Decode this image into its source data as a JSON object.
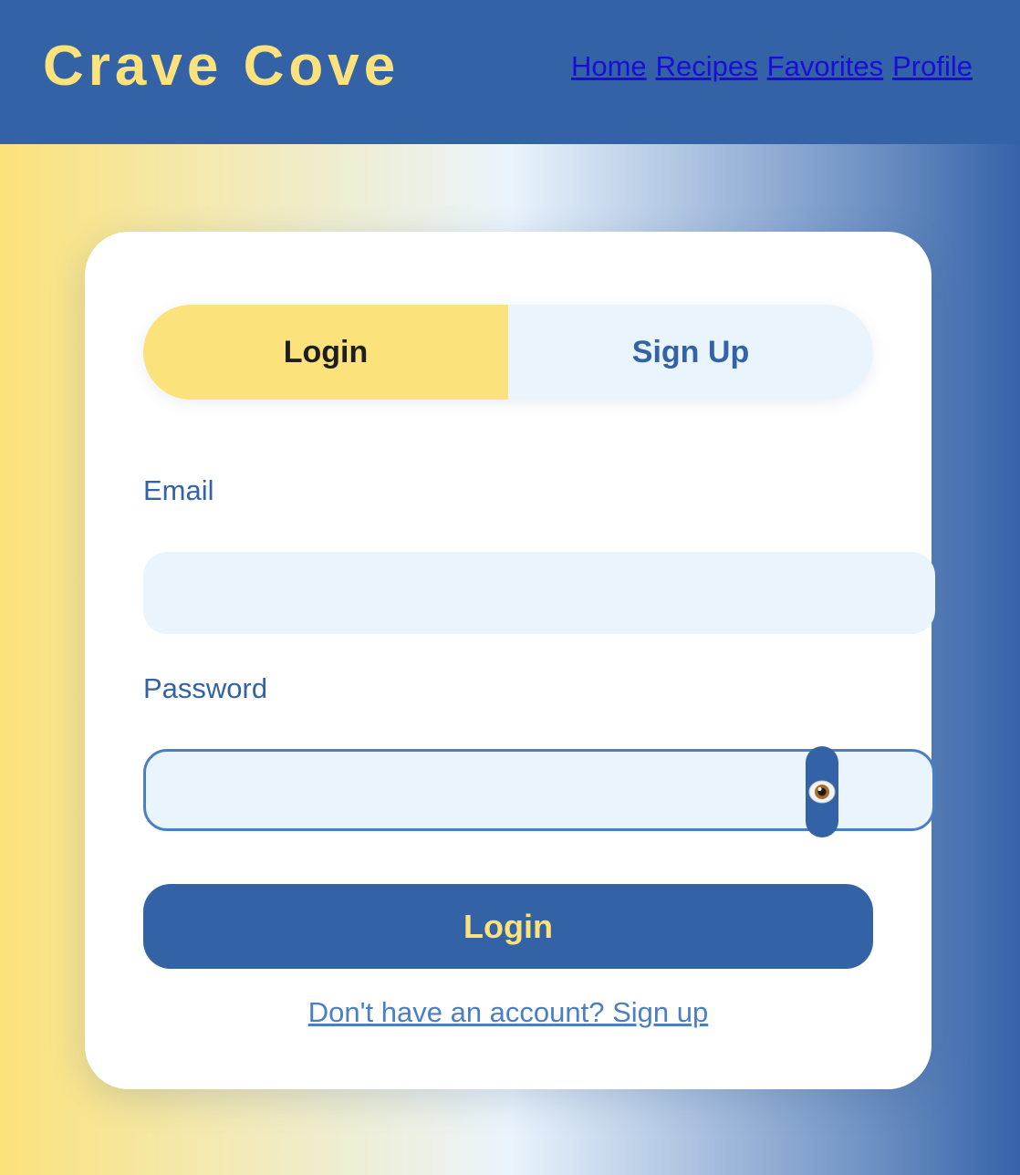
{
  "header": {
    "brand": "Crave Cove",
    "nav": [
      "Home",
      "Recipes",
      "Favorites",
      "Profile"
    ]
  },
  "auth": {
    "tabs": {
      "login": "Login",
      "signup": "Sign Up",
      "active": "login"
    },
    "email": {
      "label": "Email",
      "value": "",
      "placeholder": ""
    },
    "password": {
      "label": "Password",
      "value": "",
      "placeholder": "",
      "toggle_icon": "eye-icon"
    },
    "submit_label": "Login",
    "switch_link": "Don't have an account? Sign up"
  },
  "colors": {
    "primary_blue": "#3363a6",
    "accent_yellow": "#fbe27b",
    "field_bg": "#eaf4fc",
    "link_blue": "#1a0dd9"
  }
}
